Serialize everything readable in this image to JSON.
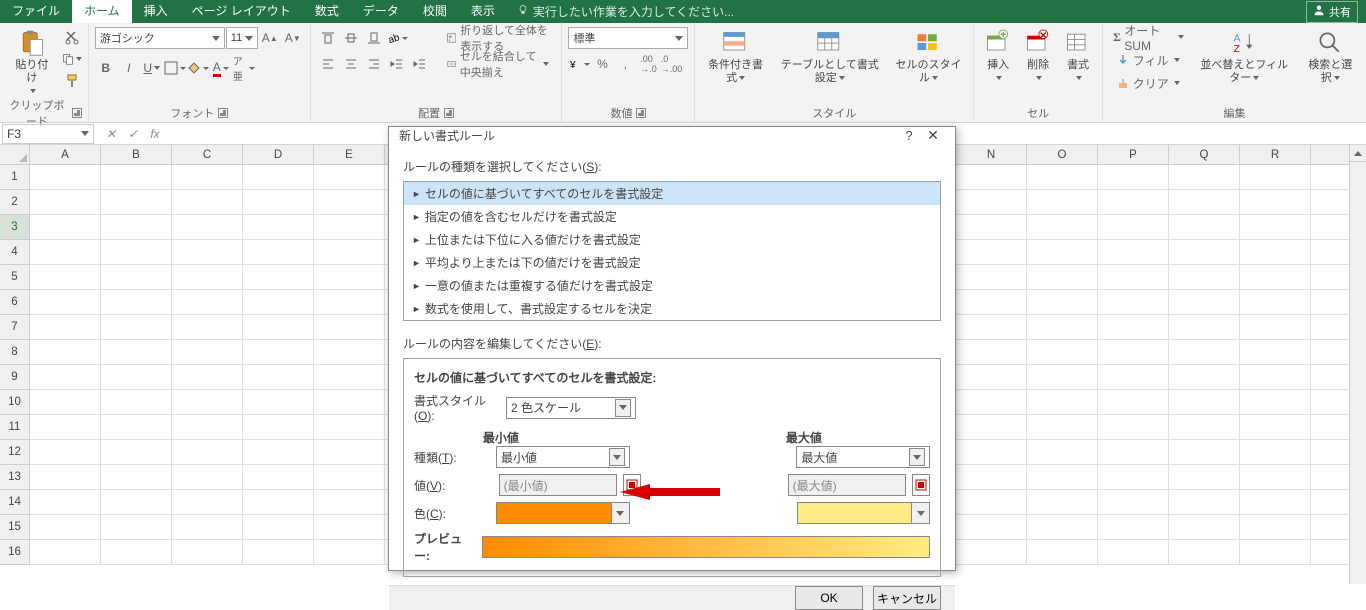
{
  "tabs": {
    "file": "ファイル",
    "home": "ホーム",
    "insert": "挿入",
    "pageLayout": "ページ レイアウト",
    "formulas": "数式",
    "data": "データ",
    "review": "校閲",
    "view": "表示"
  },
  "tellMe": "実行したい作業を入力してください...",
  "share": "共有",
  "ribbon": {
    "clipboard": {
      "label": "クリップボード",
      "paste": "貼り付け"
    },
    "font": {
      "label": "フォント",
      "name": "游ゴシック",
      "size": "11"
    },
    "alignment": {
      "label": "配置",
      "wrap": "折り返して全体を表示する",
      "merge": "セルを結合して中央揃え"
    },
    "number": {
      "label": "数値",
      "format": "標準"
    },
    "styles": {
      "label": "スタイル",
      "cond": "条件付き書式",
      "table": "テーブルとして書式設定",
      "cell": "セルのスタイル"
    },
    "cells": {
      "label": "セル",
      "insert": "挿入",
      "delete": "削除",
      "format": "書式"
    },
    "editing": {
      "label": "編集",
      "autosum": "オート SUM",
      "fill": "フィル",
      "clear": "クリア",
      "sort": "並べ替えとフィルター",
      "find": "検索と選択"
    }
  },
  "namebox": "F3",
  "cols": [
    "A",
    "B",
    "C",
    "D",
    "E",
    "N",
    "O",
    "P",
    "Q",
    "R"
  ],
  "rows": [
    "1",
    "2",
    "3",
    "4",
    "5",
    "6",
    "7",
    "8",
    "9",
    "10",
    "11",
    "12",
    "13",
    "14",
    "15",
    "16"
  ],
  "dialog": {
    "title": "新しい書式ルール",
    "help": "?",
    "selectLabelPre": "ルールの種類を選択してください(",
    "selectKey": "S",
    "selectLabelPost": "):",
    "rules": [
      "セルの値に基づいてすべてのセルを書式設定",
      "指定の値を含むセルだけを書式設定",
      "上位または下位に入る値だけを書式設定",
      "平均より上または下の値だけを書式設定",
      "一意の値または重複する値だけを書式設定",
      "数式を使用して、書式設定するセルを決定"
    ],
    "editLabelPre": "ルールの内容を編集してください(",
    "editKey": "E",
    "editLabelPost": "):",
    "boldLbl": "セルの値に基づいてすべてのセルを書式設定:",
    "styleLblPre": "書式スタイル(",
    "styleKey": "O",
    "styleLblPost": "):",
    "styleVal": "2 色スケール",
    "minHead": "最小値",
    "maxHead": "最大値",
    "typeLblPre": "種類(",
    "typeKey": "T",
    "typeLblPost": "):",
    "typeMin": "最小値",
    "typeMax": "最大値",
    "valLblPre": "値(",
    "valKey": "V",
    "valLblPost": "):",
    "valMinPh": "(最小値)",
    "valMaxPh": "(最大値)",
    "colorLblPre": "色(",
    "colorKey": "C",
    "colorLblPost": "):",
    "previewLbl": "プレビュー:",
    "ok": "OK",
    "cancel": "キャンセル"
  }
}
